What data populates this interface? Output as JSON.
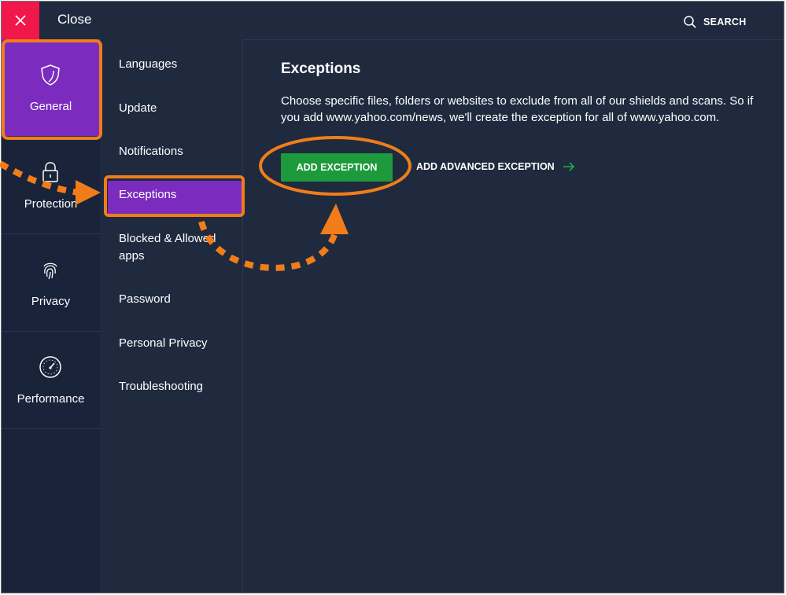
{
  "topbar": {
    "close_label": "Close",
    "search_label": "SEARCH"
  },
  "left_nav": [
    {
      "label": "General",
      "icon": "shield-icon"
    },
    {
      "label": "Protection",
      "icon": "lock-icon"
    },
    {
      "label": "Privacy",
      "icon": "fingerprint-icon"
    },
    {
      "label": "Performance",
      "icon": "speedometer-icon"
    }
  ],
  "settings_menu": {
    "items": [
      "Languages",
      "Update",
      "Notifications",
      "Exceptions",
      "Blocked & Allowed apps",
      "Password",
      "Personal Privacy",
      "Troubleshooting"
    ],
    "blocked_line1": "Blocked & Allowed",
    "blocked_line2": "apps",
    "selected": "Exceptions"
  },
  "content": {
    "title": "Exceptions",
    "description": "Choose specific files, folders or websites to exclude from all of our shields and scans. So if you add www.yahoo.com/news, we'll create the exception for all of www.yahoo.com.",
    "add_exception_label": "ADD EXCEPTION",
    "add_advanced_label": "ADD ADVANCED EXCEPTION"
  },
  "colors": {
    "accent_purple": "#7b2cbf",
    "close_red": "#f0184a",
    "button_green": "#1d9a3c",
    "annotation_orange": "#f07d19",
    "background": "#1f2a3f"
  }
}
